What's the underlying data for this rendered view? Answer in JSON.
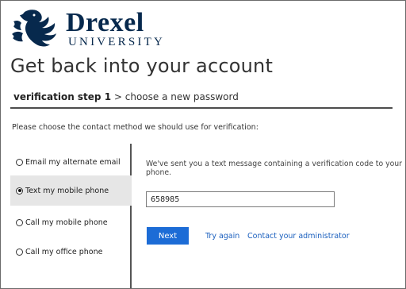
{
  "brand": {
    "name": "Drexel",
    "subtitle": "UNIVERSITY",
    "color": "#07294d"
  },
  "page": {
    "title": "Get back into your account"
  },
  "steps": {
    "current": "verification step 1",
    "separator": ">",
    "next": "choose a new password"
  },
  "prompt": "Please choose the contact method we should use for verification:",
  "methods": [
    {
      "label": "Email my alternate email",
      "selected": false
    },
    {
      "label": "Text my mobile phone",
      "selected": true
    },
    {
      "label": "Call my mobile phone",
      "selected": false
    },
    {
      "label": "Call my office phone",
      "selected": false
    }
  ],
  "panel": {
    "message": "We've sent you a text message containing a verification code to your phone.",
    "code_value": "658985",
    "next_label": "Next",
    "try_again_label": "Try again",
    "contact_admin_label": "Contact your administrator"
  },
  "colors": {
    "accent": "#1c6cd6",
    "link": "#1a5fbe",
    "selected_bg": "#e6e6e6"
  }
}
